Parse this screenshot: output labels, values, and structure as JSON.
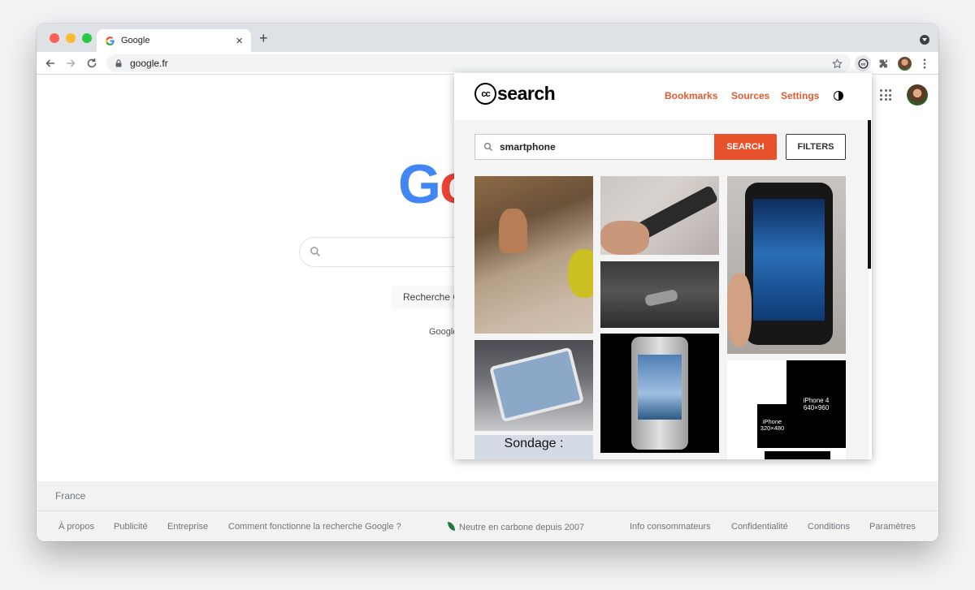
{
  "browser": {
    "tab_title": "Google",
    "url": "google.fr",
    "traffic_lights": [
      "#ff5f57",
      "#febc2e",
      "#28c840"
    ]
  },
  "google": {
    "logo_letters": [
      "G",
      "o"
    ],
    "logo_colors": [
      "#4285f4",
      "#ea4335"
    ],
    "search_button_label": "Recherche G",
    "offered_text": "Google",
    "footer_country": "France",
    "footer_links": [
      "À propos",
      "Publicité",
      "Entreprise",
      "Comment fonctionne la recherche Google ?",
      "Neutre en carbone depuis 2007",
      "Info consommateurs",
      "Confidentialité",
      "Conditions",
      "Paramètres"
    ]
  },
  "cc_popup": {
    "logo_mark": "cc",
    "logo_word": "search",
    "nav": [
      "Bookmarks",
      "Sources",
      "Settings"
    ],
    "accent_color": "#e7512b",
    "search_value": "smartphone",
    "search_button": "SEARCH",
    "filters_button": "FILTERS",
    "thumbnail_texts": {
      "sondage": "Sondage :",
      "iphone4_name": "iPhone 4",
      "iphone4_res": "640×960",
      "iphone_name": "iPhone",
      "iphone_res": "320×480"
    }
  }
}
